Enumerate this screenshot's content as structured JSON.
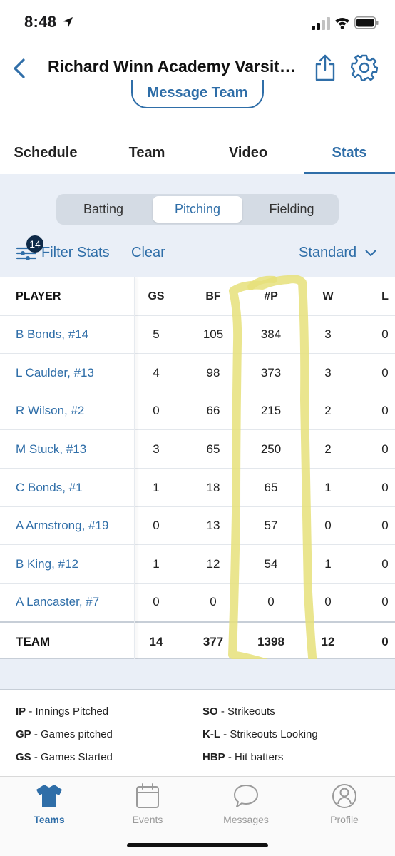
{
  "status_bar": {
    "time": "8:48"
  },
  "header": {
    "title": "Richard Winn Academy Varsity...",
    "message_button": "Message Team"
  },
  "tabs": [
    {
      "label": "Schedule",
      "active": false
    },
    {
      "label": "Team",
      "active": false
    },
    {
      "label": "Video",
      "active": false
    },
    {
      "label": "Stats",
      "active": true
    }
  ],
  "segments": [
    {
      "label": "Batting",
      "active": false
    },
    {
      "label": "Pitching",
      "active": true
    },
    {
      "label": "Fielding",
      "active": false
    }
  ],
  "filter": {
    "badge_count": "14",
    "label": "Filter Stats",
    "clear_label": "Clear",
    "view_select": "Standard"
  },
  "table": {
    "columns": [
      "PLAYER",
      "GS",
      "BF",
      "#P",
      "W",
      "L"
    ],
    "rows": [
      {
        "player": "B Bonds, #14",
        "gs": "5",
        "bf": "105",
        "p": "384",
        "w": "3",
        "l": "0"
      },
      {
        "player": "L Caulder, #13",
        "gs": "4",
        "bf": "98",
        "p": "373",
        "w": "3",
        "l": "0"
      },
      {
        "player": "R Wilson, #2",
        "gs": "0",
        "bf": "66",
        "p": "215",
        "w": "2",
        "l": "0"
      },
      {
        "player": "M Stuck, #13",
        "gs": "3",
        "bf": "65",
        "p": "250",
        "w": "2",
        "l": "0"
      },
      {
        "player": "C Bonds, #1",
        "gs": "1",
        "bf": "18",
        "p": "65",
        "w": "1",
        "l": "0"
      },
      {
        "player": "A Armstrong, #19",
        "gs": "0",
        "bf": "13",
        "p": "57",
        "w": "0",
        "l": "0"
      },
      {
        "player": "B King, #12",
        "gs": "1",
        "bf": "12",
        "p": "54",
        "w": "1",
        "l": "0"
      },
      {
        "player": "A Lancaster, #7",
        "gs": "0",
        "bf": "0",
        "p": "0",
        "w": "0",
        "l": "0"
      }
    ],
    "team": {
      "player": "TEAM",
      "gs": "14",
      "bf": "377",
      "p": "1398",
      "w": "12",
      "l": "0"
    }
  },
  "legend": [
    {
      "abbr": "IP",
      "desc": " - Innings Pitched"
    },
    {
      "abbr": "SO",
      "desc": " - Strikeouts"
    },
    {
      "abbr": "GP",
      "desc": " - Games pitched"
    },
    {
      "abbr": "K-L",
      "desc": " - Strikeouts Looking"
    },
    {
      "abbr": "GS",
      "desc": " - Games Started"
    },
    {
      "abbr": "HBP",
      "desc": " - Hit batters"
    }
  ],
  "tabbar": [
    {
      "label": "Teams",
      "icon": "jersey-icon",
      "active": true
    },
    {
      "label": "Events",
      "icon": "calendar-icon",
      "active": false
    },
    {
      "label": "Messages",
      "icon": "chat-bubble-icon",
      "active": false
    },
    {
      "label": "Profile",
      "icon": "profile-icon",
      "active": false
    }
  ],
  "colors": {
    "accent": "#2f6ea8",
    "highlight": "#e6e07a",
    "badge": "#0f2a48",
    "gray_bg": "#eaeff7"
  }
}
